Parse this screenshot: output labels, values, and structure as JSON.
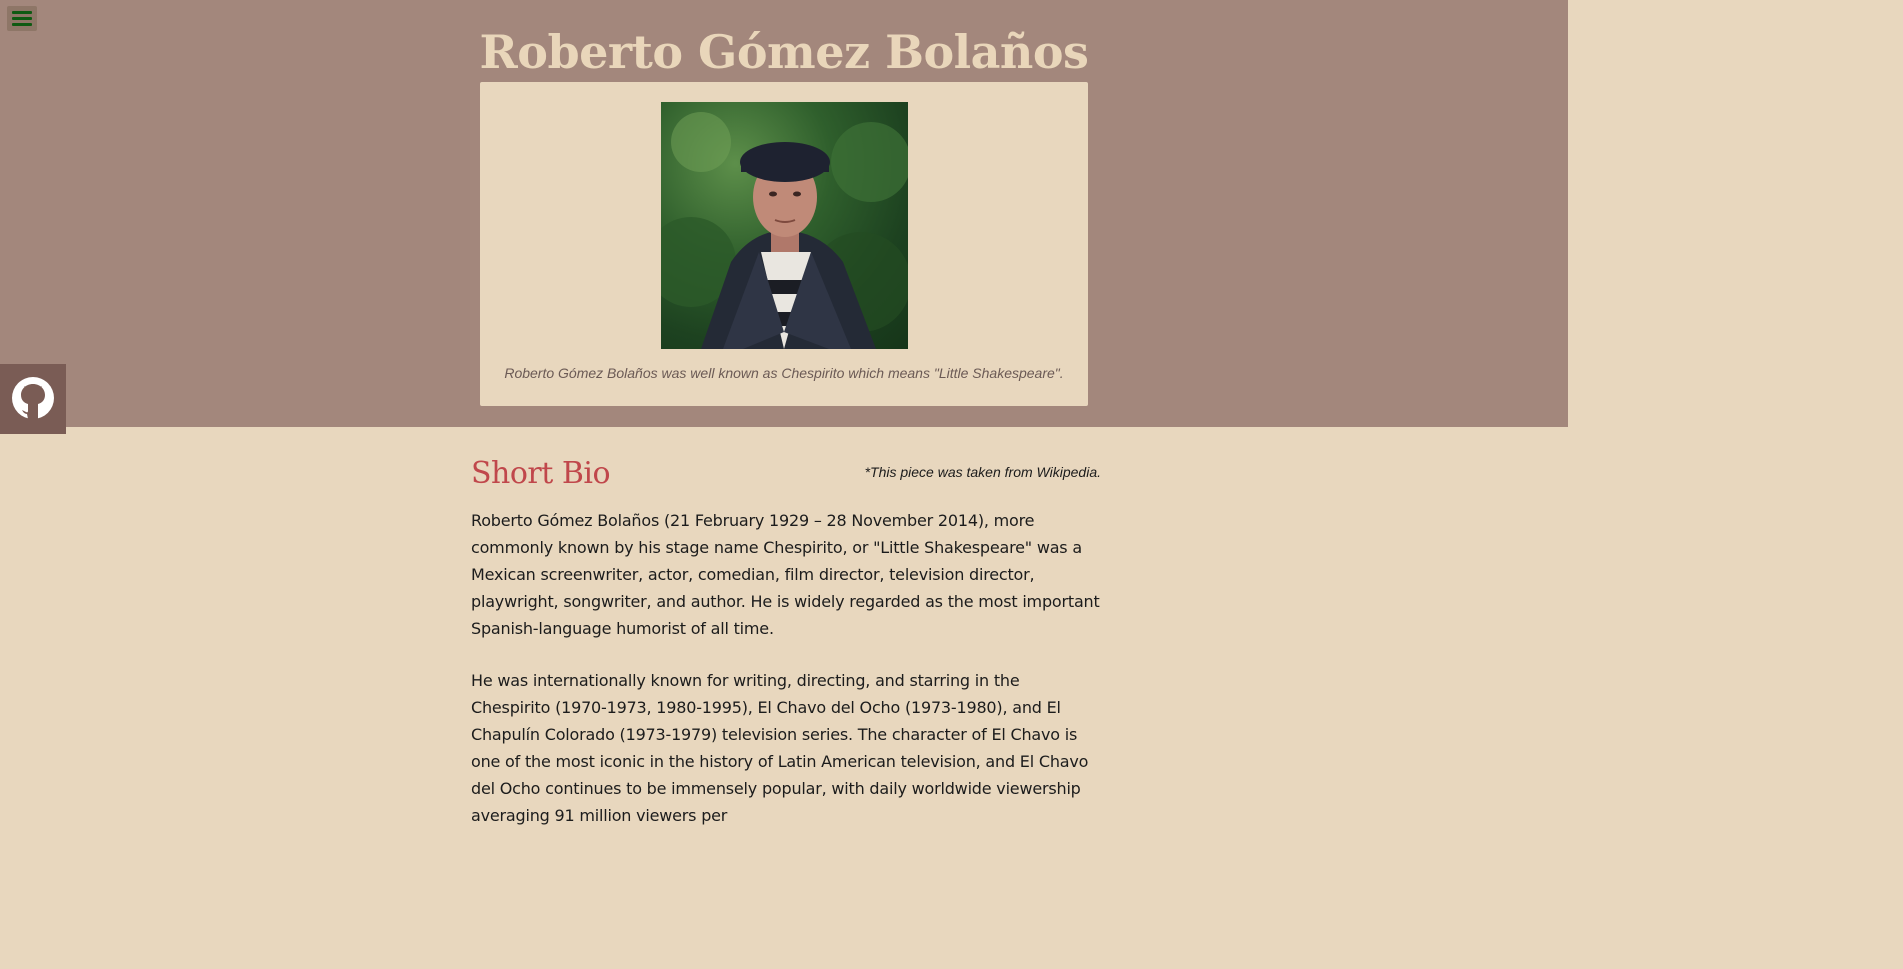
{
  "header": {
    "title": "Roberto Gómez Bolaños"
  },
  "figure": {
    "caption": "Roberto Gómez Bolaños was well known as Chespirito which means \"Little Shakespeare\"."
  },
  "icons": {
    "menu": "hamburger-menu-icon",
    "github": "github-icon"
  },
  "bio": {
    "heading": "Short Bio",
    "source_note": "*This piece was taken from Wikipedia.",
    "paragraphs": [
      "Roberto Gómez Bolaños (21 February 1929 – 28 November 2014), more commonly known by his stage name Chespirito, or \"Little Shakespeare\" was a Mexican screenwriter, actor, comedian, film director, television director, playwright, songwriter, and author. He is widely regarded as the most important Spanish-language humorist of all time.",
      "He was internationally known for writing, directing, and starring in the Chespirito (1970-1973, 1980-1995), El Chavo del Ocho (1973-1980), and El Chapulín Colorado (1973-1979) television series. The character of El Chavo is one of the most iconic in the history of Latin American television, and El Chavo del Ocho continues to be immensely popular, with daily worldwide viewership averaging 91 million viewers per"
    ]
  },
  "colors": {
    "hero_background": "#a3877c",
    "page_background": "#e8d7be",
    "heading_accent": "#c0474b",
    "title_color": "#e9d6ba"
  }
}
